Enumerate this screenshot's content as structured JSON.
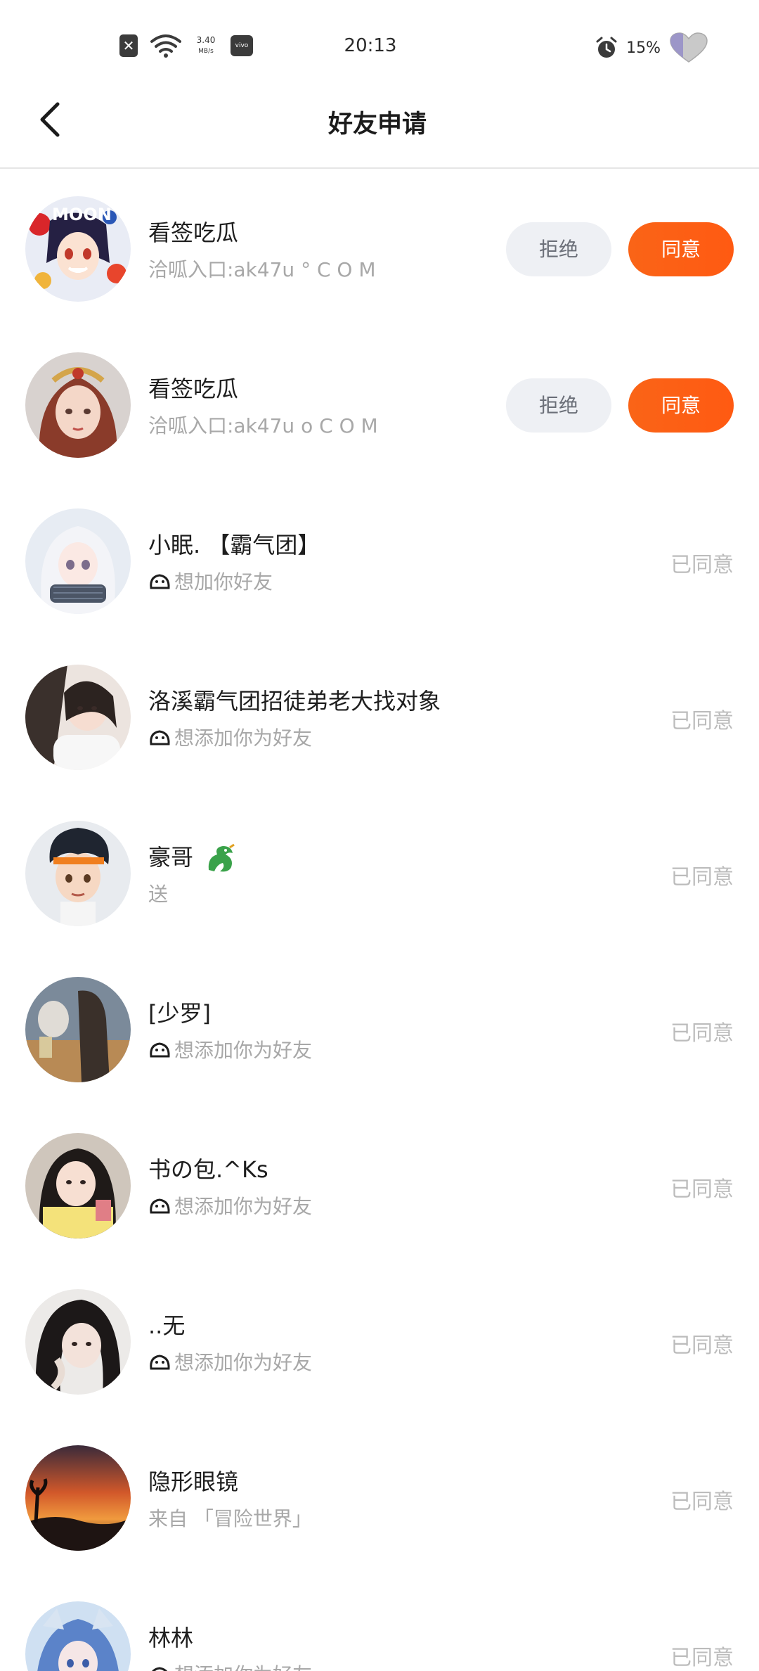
{
  "status_bar": {
    "time": "20:13",
    "net_speed_value": "3.40",
    "net_speed_unit": "MB/s",
    "carrier_badge": "vivo",
    "battery": "15%",
    "icons": [
      "sim-off-icon",
      "wifi-icon",
      "alarm-icon",
      "battery-heart-icon"
    ]
  },
  "header": {
    "title": "好友申请",
    "back_icon": "chevron-left-icon"
  },
  "colors": {
    "agree_button": "#fa6417",
    "reject_button_bg": "#eef0f4",
    "agreed_text": "#bcbcbc"
  },
  "requests": [
    {
      "name": "看签吃瓜",
      "message": "洽呱入口:ak47u ° C O M",
      "action": "pending",
      "reject_label": "拒绝",
      "agree_label": "同意"
    },
    {
      "name": "看签吃瓜",
      "message": "洽呱入口:ak47u o C O M",
      "action": "pending",
      "reject_label": "拒绝",
      "agree_label": "同意"
    },
    {
      "name": "小眠. 【霸气团】",
      "message": "想加你好友",
      "action": "agreed",
      "status_label": "已同意",
      "message_icon": "app-mascot-icon"
    },
    {
      "name": "洛溪霸气团招徒弟老大找对象",
      "message": "想添加你为好友",
      "action": "agreed",
      "status_label": "已同意",
      "message_icon": "app-mascot-icon"
    },
    {
      "name": "豪哥",
      "name_icon": "dragon-emoji-icon",
      "message": "送",
      "action": "agreed",
      "status_label": "已同意"
    },
    {
      "name": "[少罗]",
      "message": "想添加你为好友",
      "action": "agreed",
      "status_label": "已同意",
      "message_icon": "app-mascot-icon"
    },
    {
      "name": "书の包.^Ks",
      "message": "想添加你为好友",
      "action": "agreed",
      "status_label": "已同意",
      "message_icon": "app-mascot-icon"
    },
    {
      "name": "..无",
      "message": "想添加你为好友",
      "action": "agreed",
      "status_label": "已同意",
      "message_icon": "app-mascot-icon"
    },
    {
      "name": "隐形眼镜",
      "message": "来自 「冒险世界」",
      "action": "agreed",
      "status_label": "已同意"
    },
    {
      "name": "林林",
      "message": "想添加你为好友",
      "action": "agreed",
      "status_label": "已同意",
      "message_icon": "app-mascot-icon"
    }
  ]
}
